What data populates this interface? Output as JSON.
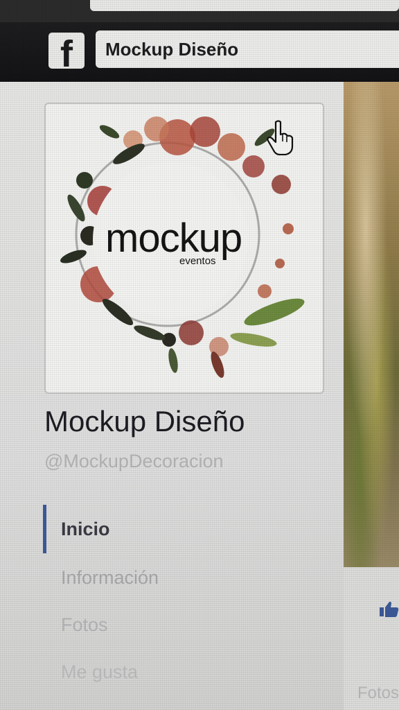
{
  "header": {
    "brand_icon": "facebook-icon",
    "page_title": "Mockup Diseño"
  },
  "profile": {
    "logo_word": "mockup",
    "logo_subtext": "eventos",
    "name": "Mockup Diseño",
    "handle": "@MockupDecoracion"
  },
  "nav": {
    "items": [
      {
        "label": "Inicio",
        "active": true
      },
      {
        "label": "Información",
        "active": false
      },
      {
        "label": "Fotos",
        "active": false
      },
      {
        "label": "Me gusta",
        "active": false
      }
    ]
  },
  "right_panel": {
    "fotos_label": "Fotos",
    "like_icon": "thumbs-up-icon"
  },
  "colors": {
    "active_nav_indicator": "#3d5a98",
    "header_bar": "#1d1d1f"
  }
}
